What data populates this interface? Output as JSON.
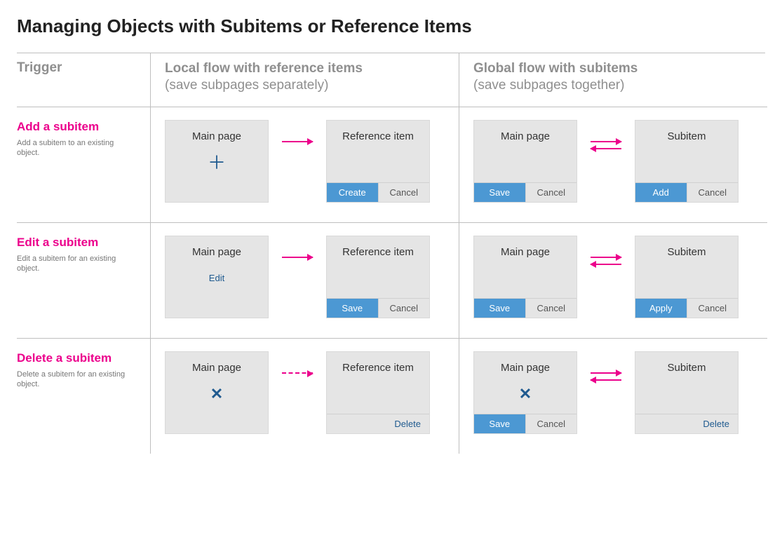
{
  "title": "Managing Objects with Subitems or Reference Items",
  "headers": {
    "trigger": "Trigger",
    "local": {
      "title": "Local flow with reference items",
      "sub": "(save subpages separately)"
    },
    "global": {
      "title": "Global flow with subitems",
      "sub": "(save subpages together)"
    }
  },
  "labels": {
    "main_page": "Main page",
    "reference_item": "Reference item",
    "subitem": "Subitem",
    "edit": "Edit",
    "create": "Create",
    "save": "Save",
    "cancel": "Cancel",
    "add": "Add",
    "apply": "Apply",
    "delete": "Delete"
  },
  "rows": [
    {
      "title": "Add a subitem",
      "desc": "Add a subitem to an existing object."
    },
    {
      "title": "Edit a subitem",
      "desc": "Edit a subitem for an existing object."
    },
    {
      "title": "Delete a subitem",
      "desc": "Delete a subitem for an existing object."
    }
  ]
}
